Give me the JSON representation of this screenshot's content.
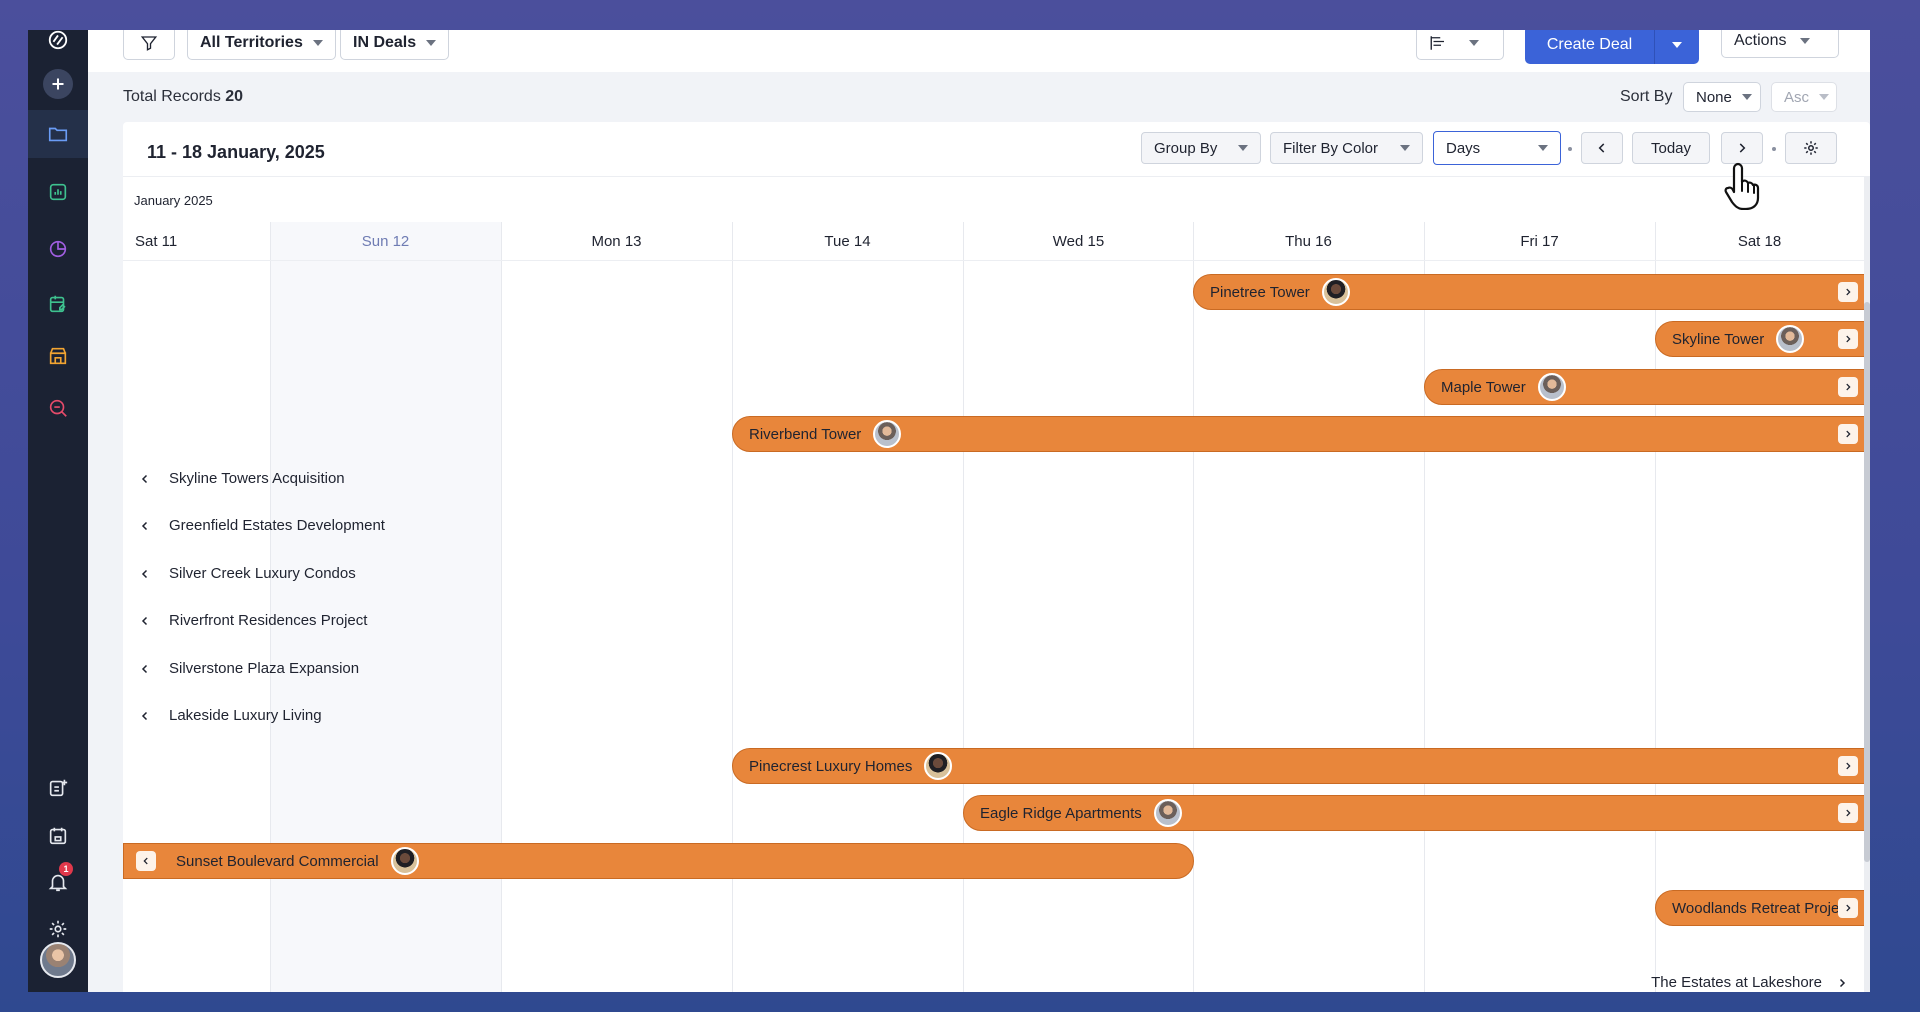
{
  "toolbar": {
    "territory_label": "All Territories",
    "module_label": "IN Deals",
    "create_deal_label": "Create Deal",
    "actions_label": "Actions"
  },
  "summary": {
    "total_records_label": "Total Records",
    "total_records_count": "20",
    "sort_by_label": "Sort By",
    "sort_field": "None",
    "sort_order": "Asc"
  },
  "calendar": {
    "range_title": "11 - 18 January, 2025",
    "group_by_label": "Group By",
    "filter_by_color_label": "Filter By Color",
    "view_mode": "Days",
    "today_label": "Today",
    "month_label": "January 2025",
    "days": [
      "Sat 11",
      "Sun 12",
      "Mon 13",
      "Tue 14",
      "Wed 15",
      "Thu 16",
      "Fri 17",
      "Sat 18"
    ]
  },
  "deals": [
    {
      "name": "Pinetree Tower"
    },
    {
      "name": "Skyline Tower"
    },
    {
      "name": "Maple Tower"
    },
    {
      "name": "Riverbend Tower"
    },
    {
      "name": "Skyline Towers Acquisition"
    },
    {
      "name": "Greenfield Estates Development"
    },
    {
      "name": "Silver Creek Luxury Condos"
    },
    {
      "name": "Riverfront Residences Project"
    },
    {
      "name": "Silverstone Plaza Expansion"
    },
    {
      "name": "Lakeside Luxury Living"
    },
    {
      "name": "Pinecrest Luxury Homes"
    },
    {
      "name": "Eagle Ridge Apartments"
    },
    {
      "name": "Sunset Boulevard Commercial"
    },
    {
      "name": "Woodlands Retreat Project"
    },
    {
      "name": "The Estates at Lakeshore"
    }
  ],
  "icons": {
    "brand": "brand-logo-icon",
    "create": "plus-icon",
    "nav": [
      "folder-icon",
      "analytics-icon",
      "pie-chart-icon",
      "tasks-icon",
      "store-icon",
      "search-icon"
    ],
    "bottom": [
      "notes-add-icon",
      "calendar-icon",
      "bell-icon",
      "settings-icon"
    ]
  },
  "notifications": {
    "count": "1"
  },
  "colors": {
    "bar": "#e8863b",
    "primary": "#3b63d8",
    "rail": "#1b2233"
  }
}
